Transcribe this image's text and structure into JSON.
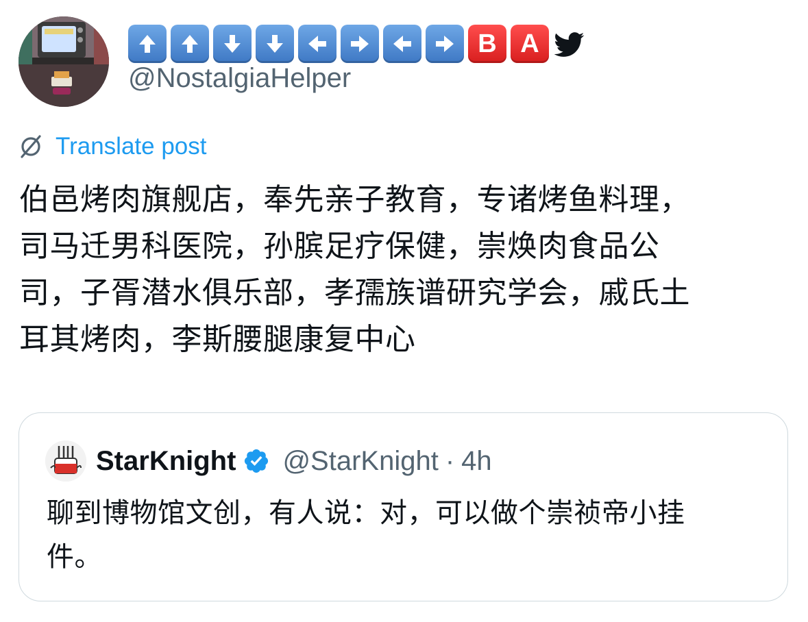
{
  "post": {
    "author_handle": "@NostalgiaHelper",
    "name_keys": [
      {
        "glyph": "⬆",
        "color": "#4a86d4"
      },
      {
        "glyph": "⬆",
        "color": "#4a86d4"
      },
      {
        "glyph": "⬇",
        "color": "#4a86d4"
      },
      {
        "glyph": "⬇",
        "color": "#4a86d4"
      },
      {
        "glyph": "⬅",
        "color": "#4a86d4"
      },
      {
        "glyph": "➡",
        "color": "#4a86d4"
      },
      {
        "glyph": "⬅",
        "color": "#4a86d4"
      },
      {
        "glyph": "➡",
        "color": "#4a86d4"
      },
      {
        "glyph": "B",
        "color": "#e02424"
      },
      {
        "glyph": "A",
        "color": "#e02424"
      }
    ],
    "translate_label": "Translate post",
    "text": "伯邑烤肉旗舰店，奉先亲子教育，专诸烤鱼料理，\n司马迁男科医院，孙膑足疗保健，崇焕肉食品公\n司，子胥潜水俱乐部，孝孺族谱研究学会，戚氏土\n耳其烤肉，李斯腰腿康复中心"
  },
  "quote": {
    "name": "StarKnight",
    "handle": "@StarKnight",
    "separator": "·",
    "time": "4h",
    "text": "聊到博物馆文创，有人说：对，可以做个崇祯帝小挂\n件。"
  },
  "colors": {
    "accent": "#1d9bf0",
    "secondary_text": "#536471",
    "border": "#cfd9de"
  },
  "icons": {
    "bird": "twitter-bird-icon",
    "translate": "translate-globe-icon",
    "verified": "verified-badge-icon"
  }
}
